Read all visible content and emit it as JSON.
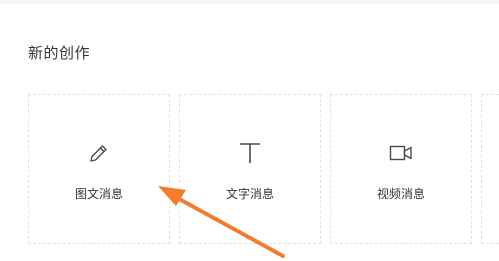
{
  "section": {
    "title": "新的创作"
  },
  "cards": [
    {
      "label": "图文消息",
      "icon": "pencil-icon"
    },
    {
      "label": "文字消息",
      "icon": "text-t-icon"
    },
    {
      "label": "视频消息",
      "icon": "video-camera-icon"
    },
    {
      "label": "",
      "icon": ""
    }
  ],
  "annotation": {
    "color": "#f27d2e",
    "icon": "arrow-pointer"
  },
  "colors": {
    "text": "#353535",
    "border": "#e1e1e1",
    "background": "#ffffff"
  }
}
